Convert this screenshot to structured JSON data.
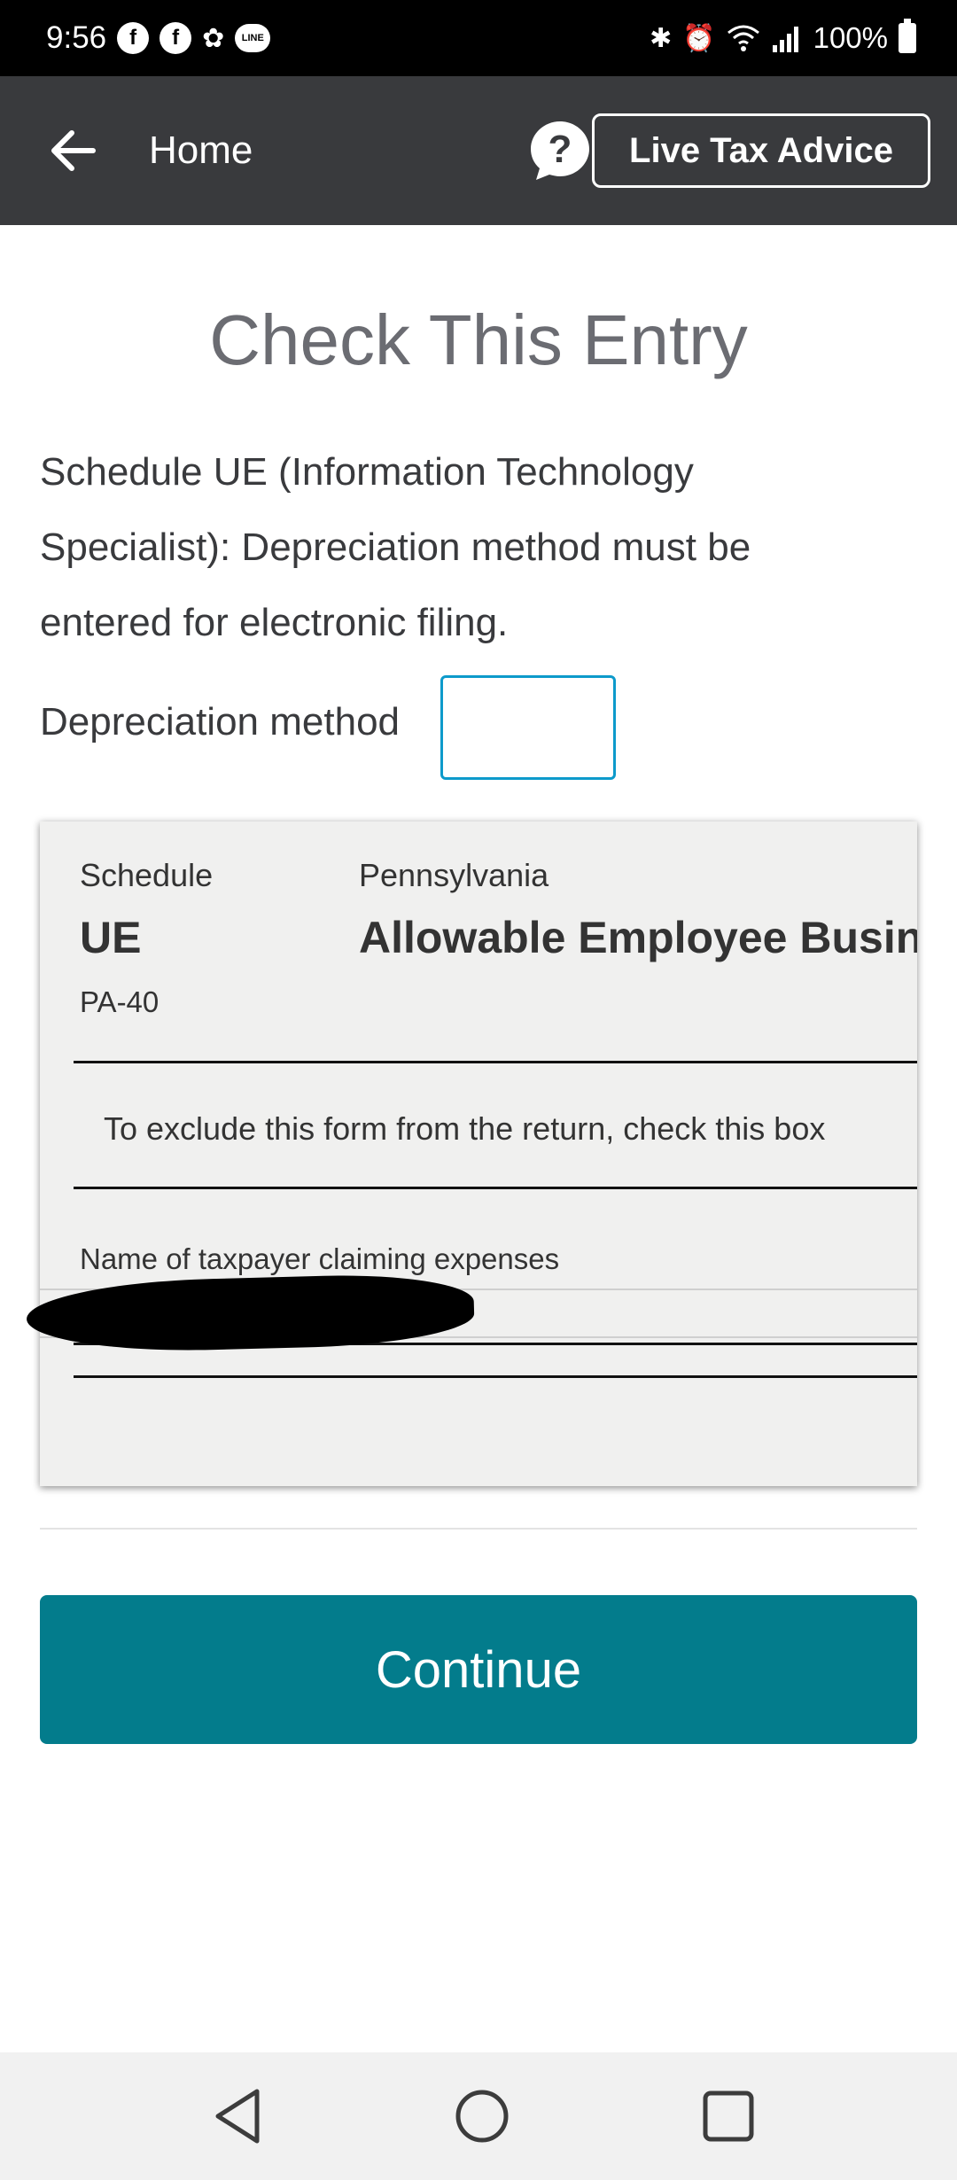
{
  "status_bar": {
    "time": "9:56",
    "app_icons": [
      "facebook-icon",
      "facebook-icon",
      "pinwheel-icon",
      "line-icon"
    ],
    "line_label": "LINE",
    "battery": "100%"
  },
  "header": {
    "back_icon": "arrow-left-icon",
    "home_label": "Home",
    "help_icon": "question-bubble-icon",
    "live_advice_label": "Live Tax Advice"
  },
  "main": {
    "title": "Check This Entry",
    "message": "Schedule UE (Information Technology Specialist): Depreciation method must be entered for electronic filing.",
    "field_label": "Depreciation method",
    "field_value": ""
  },
  "form_preview": {
    "schedule_label": "Schedule",
    "schedule_code": "UE",
    "form_number": "PA-40",
    "state": "Pennsylvania",
    "form_title": "Allowable Employee Business Expenses",
    "exclude_text": "To exclude this form from the return, check this box",
    "name_label": "Name of taxpayer claiming expenses"
  },
  "continue_label": "Continue",
  "colors": {
    "header_bg": "#393a3d",
    "continue_bg": "#037c8c",
    "input_border": "#0d9acb"
  }
}
